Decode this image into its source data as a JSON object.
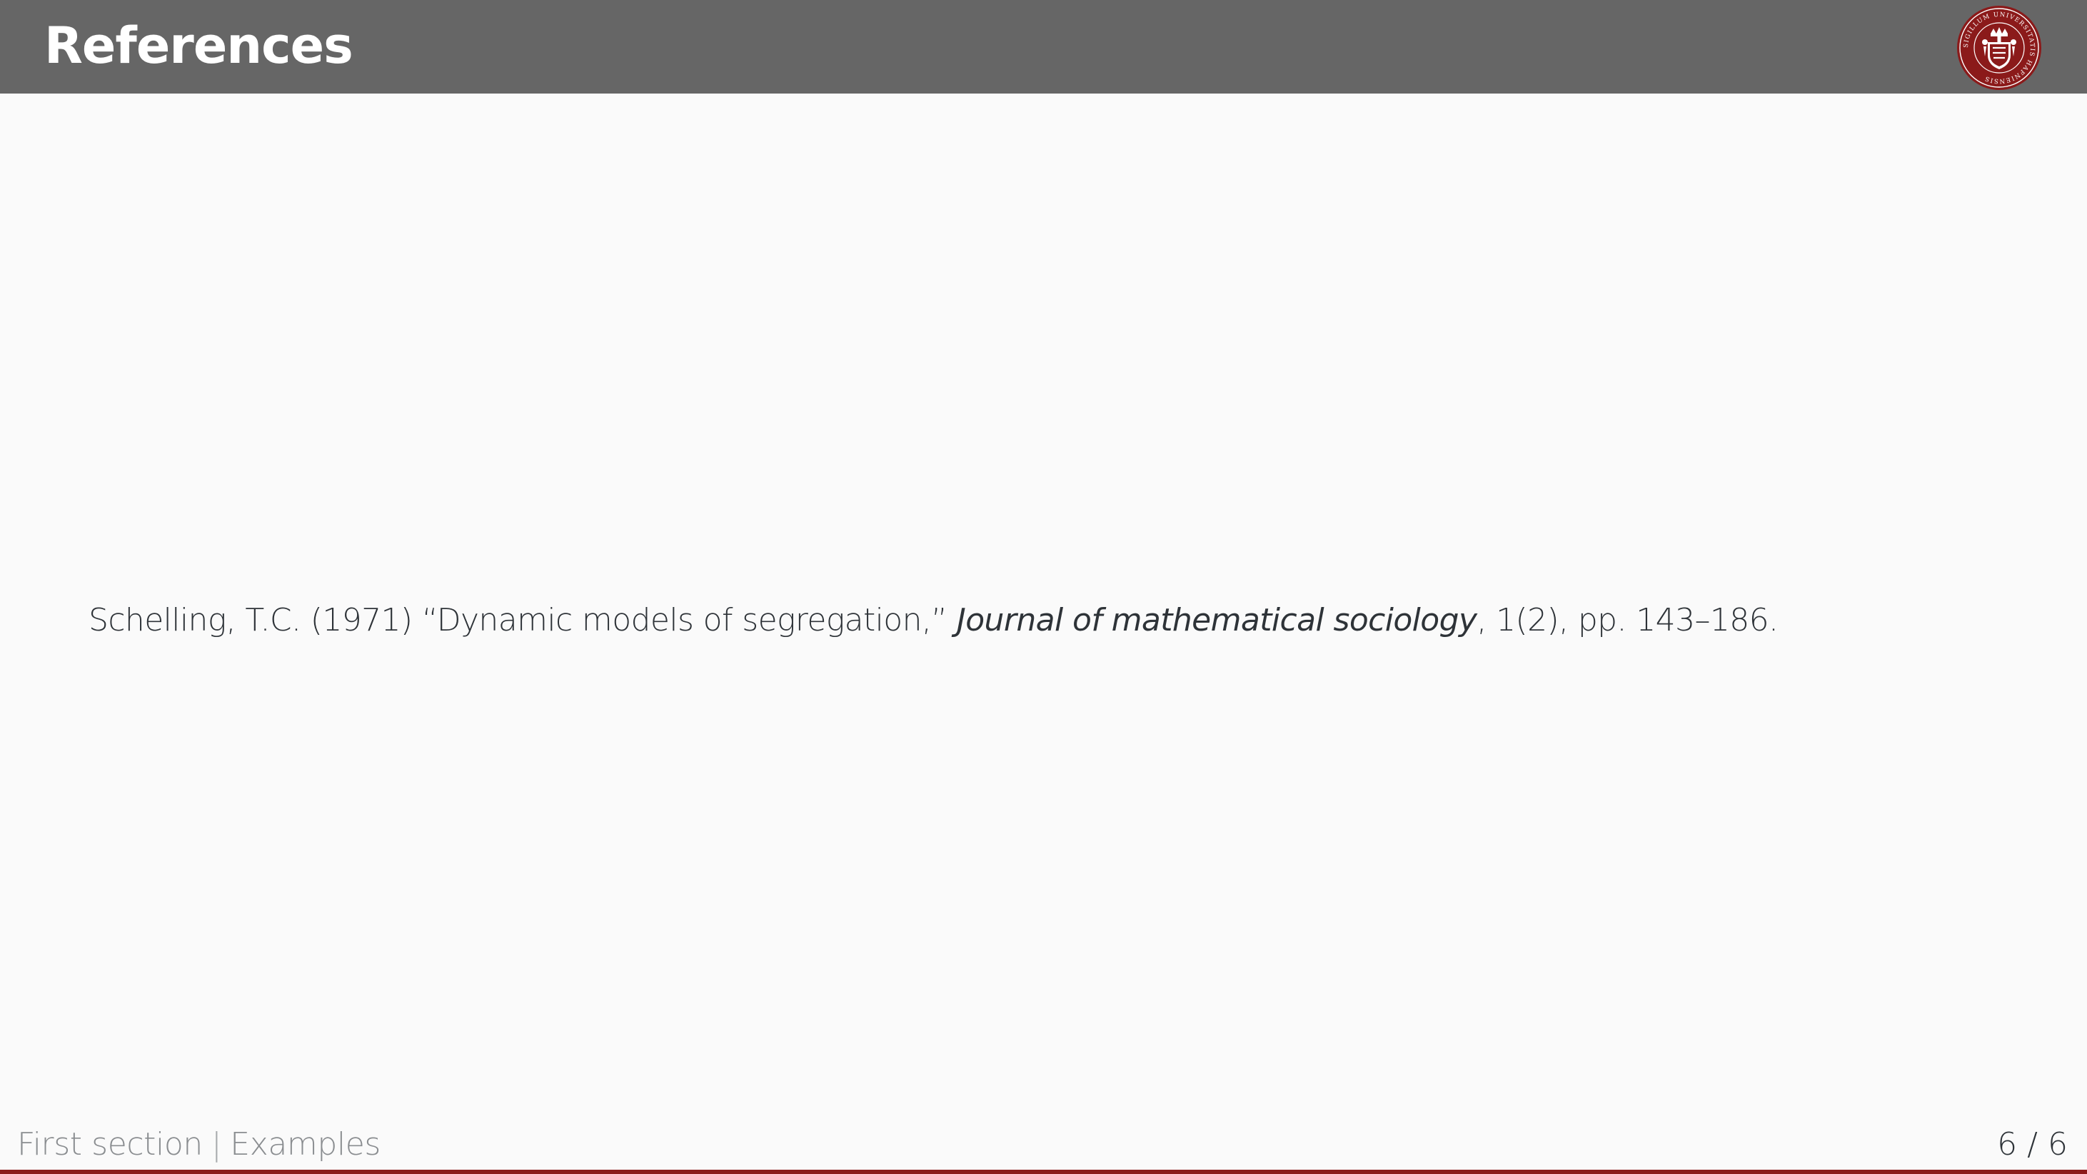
{
  "header": {
    "title": "References",
    "logo": {
      "icon": "university-seal-icon",
      "ring_text": "SIGILLUM UNIVERSITATIS HAFNIENSIS",
      "color": "#8b1a1a"
    },
    "background_color": "#666666"
  },
  "body": {
    "reference": {
      "authors_year": "Schelling, T.C. (1971) ",
      "article_title": "“Dynamic models of segregation,” ",
      "journal": "Journal of mathematical sociology",
      "details": ", 1(2), pp. 143–186."
    }
  },
  "footer": {
    "section": "First section",
    "separator": "|",
    "subsection": "Examples",
    "page_current": "6",
    "page_separator": "/",
    "page_total": "6",
    "accent_color": "#8b1a1a"
  }
}
